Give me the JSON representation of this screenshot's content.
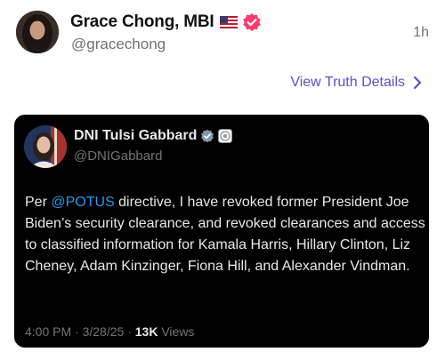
{
  "post": {
    "author_name": "Grace Chong, MBI",
    "flag_icon": "us-flag-icon",
    "verified_icon": "verified-badge-icon",
    "verified_color": "#ff3b6b",
    "handle": "@gracechong",
    "timestamp": "1h",
    "details_link": "View Truth Details",
    "link_color": "#5a4fcf"
  },
  "embedded_tweet": {
    "author_name": "DNI Tulsi Gabbard",
    "verified_icon": "gray-verified-check-icon",
    "affiliation_icon": "government-seal-icon",
    "handle": "@DNIGabbard",
    "body_prefix": "Per ",
    "mention": "@POTUS",
    "body_suffix": " directive, I have revoked former President Joe Biden’s security clearance, and revoked clearances and access to classified information for Kamala Harris, Hillary Clinton, Liz Cheney, Adam Kinzinger, Fiona Hill, and Alexander Vindman.",
    "time": "4:00 PM",
    "separator": " · ",
    "date": "3/28/25",
    "views_count": "13K",
    "views_label": " Views",
    "mention_color": "#1d9bf0",
    "background_color": "#000000"
  }
}
